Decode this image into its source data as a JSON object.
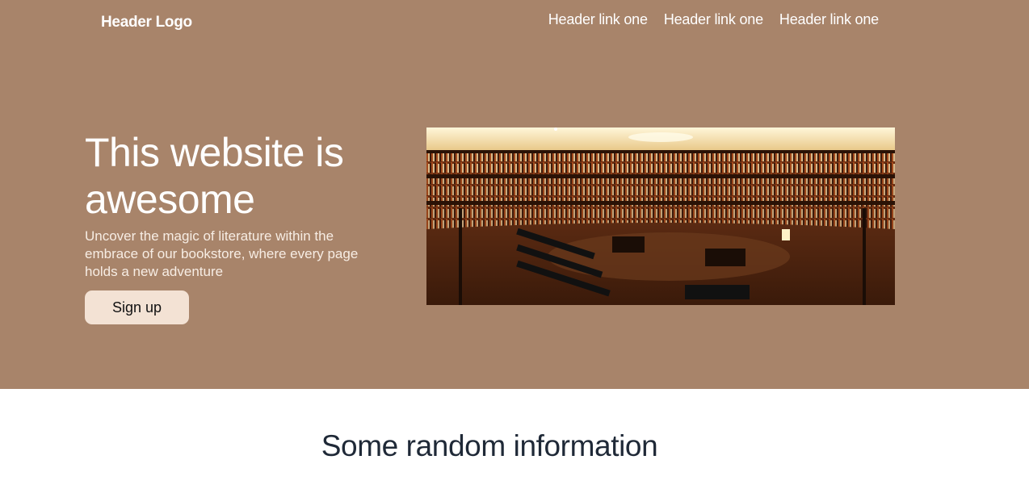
{
  "header": {
    "logo": "Header Logo",
    "links": [
      "Header link one",
      "Header link one",
      "Header link one"
    ]
  },
  "hero": {
    "title": "This website is awesome",
    "subtitle": "Uncover the magic of literature within the embrace of our bookstore, where every page holds a new adventure",
    "cta_label": "Sign up",
    "image": "library-interior-photo"
  },
  "section": {
    "title": "Some random information"
  },
  "colors": {
    "hero_bg": "#a8846a",
    "button_bg": "#f3e2d4",
    "heading_dark": "#1f2937"
  }
}
